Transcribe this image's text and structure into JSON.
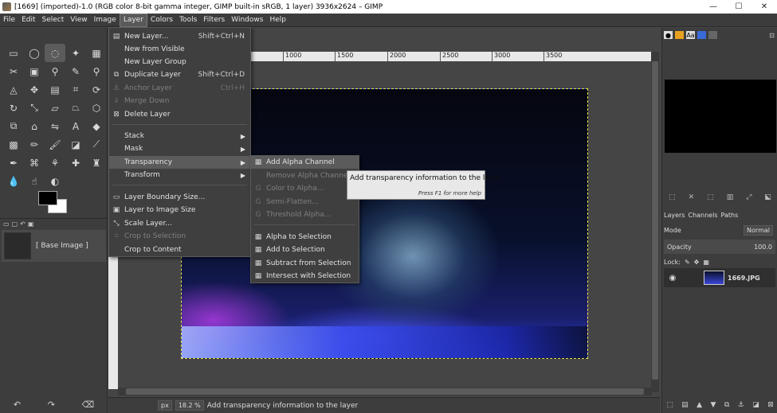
{
  "window": {
    "title": "[1669] (imported)-1.0 (RGB color 8-bit gamma integer, GIMP built-in sRGB, 1 layer) 3936x2624 – GIMP",
    "minimize": "—",
    "maximize": "☐",
    "close": "✕"
  },
  "menubar": [
    "File",
    "Edit",
    "Select",
    "View",
    "Image",
    "Layer",
    "Colors",
    "Tools",
    "Filters",
    "Windows",
    "Help"
  ],
  "layer_menu": {
    "new_layer": "New Layer...",
    "new_layer_sc": "Shift+Ctrl+N",
    "new_from_visible": "New from Visible",
    "new_layer_group": "New Layer Group",
    "duplicate_layer": "Duplicate Layer",
    "duplicate_layer_sc": "Shift+Ctrl+D",
    "anchor_layer": "Anchor Layer",
    "anchor_layer_sc": "Ctrl+H",
    "merge_down": "Merge Down",
    "delete_layer": "Delete Layer",
    "stack": "Stack",
    "mask": "Mask",
    "transparency": "Transparency",
    "transform": "Transform",
    "layer_boundary_size": "Layer Boundary Size...",
    "layer_to_image_size": "Layer to Image Size",
    "scale_layer": "Scale Layer...",
    "crop_to_selection": "Crop to Selection",
    "crop_to_content": "Crop to Content"
  },
  "transparency_menu": {
    "add_alpha": "Add Alpha Channel",
    "remove_alpha": "Remove Alpha Channel",
    "color_to_alpha": "Color to Alpha...",
    "semi_flatten": "Semi-Flatten...",
    "threshold_alpha": "Threshold Alpha...",
    "alpha_to_selection": "Alpha to Selection",
    "add_to_selection": "Add to Selection",
    "subtract_from_selection": "Subtract from Selection",
    "intersect_with_selection": "Intersect with Selection"
  },
  "tooltip": {
    "text": "Add transparency information to the layer",
    "help": "Press F1 for more help"
  },
  "ruler": [
    "1000",
    "1500",
    "2000",
    "2500",
    "3000",
    "3500"
  ],
  "images_panel": {
    "item": "[ Base Image ]"
  },
  "dock": {
    "tab_layers": "Layers",
    "tab_channels": "Channels",
    "tab_paths": "Paths",
    "mode_label": "Mode",
    "mode_value": "Normal",
    "opacity_label": "Opacity",
    "opacity_value": "100.0",
    "lock_label": "Lock:",
    "layer_name": "1669.JPG"
  },
  "statusbar": {
    "unit": "px",
    "zoom": "18.2 %",
    "message": "Add transparency information to the layer"
  },
  "colors": {
    "accent_highlight": "#5b5b5b",
    "selection_border": "#e8e84a"
  }
}
